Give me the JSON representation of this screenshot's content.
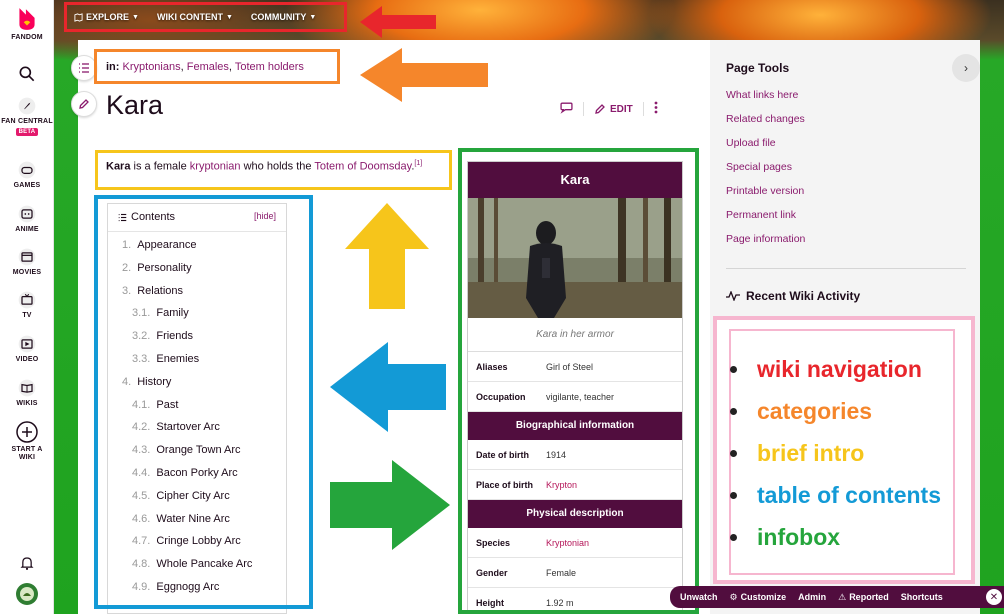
{
  "brand": {
    "name": "FANDOM"
  },
  "rail": {
    "items": [
      {
        "label": "FAN CENTRAL",
        "badge": "BETA",
        "icon": "rocket-icon"
      },
      {
        "label": "GAMES",
        "icon": "gamepad-icon"
      },
      {
        "label": "ANIME",
        "icon": "anime-icon"
      },
      {
        "label": "MOVIES",
        "icon": "movie-icon"
      },
      {
        "label": "TV",
        "icon": "tv-icon"
      },
      {
        "label": "VIDEO",
        "icon": "video-icon"
      },
      {
        "label": "WIKIS",
        "icon": "book-icon"
      },
      {
        "label": "START A WIKI",
        "icon": "plus-circle-icon"
      }
    ]
  },
  "topnav": {
    "items": [
      {
        "label": "EXPLORE"
      },
      {
        "label": "WIKI CONTENT"
      },
      {
        "label": "COMMUNITY"
      }
    ]
  },
  "article": {
    "categories_prefix": "in:",
    "categories": [
      "Kryptonians",
      "Females",
      "Totem holders"
    ],
    "title": "Kara",
    "edit_label": "EDIT",
    "intro": {
      "subject": "Kara",
      "text1": " is a female ",
      "link1": "kryptonian",
      "text2": " who holds the ",
      "link2": "Totem of Doomsday",
      "text3": ".",
      "ref": "[1]"
    }
  },
  "toc": {
    "title": "Contents",
    "hide_label": "[hide]",
    "items": [
      {
        "num": "1.",
        "label": "Appearance",
        "level": 1
      },
      {
        "num": "2.",
        "label": "Personality",
        "level": 1
      },
      {
        "num": "3.",
        "label": "Relations",
        "level": 1
      },
      {
        "num": "3.1.",
        "label": "Family",
        "level": 2
      },
      {
        "num": "3.2.",
        "label": "Friends",
        "level": 2
      },
      {
        "num": "3.3.",
        "label": "Enemies",
        "level": 2
      },
      {
        "num": "4.",
        "label": "History",
        "level": 1
      },
      {
        "num": "4.1.",
        "label": "Past",
        "level": 2
      },
      {
        "num": "4.2.",
        "label": "Startover Arc",
        "level": 2
      },
      {
        "num": "4.3.",
        "label": "Orange Town Arc",
        "level": 2
      },
      {
        "num": "4.4.",
        "label": "Bacon Porky Arc",
        "level": 2
      },
      {
        "num": "4.5.",
        "label": "Cipher City Arc",
        "level": 2
      },
      {
        "num": "4.6.",
        "label": "Water Nine Arc",
        "level": 2
      },
      {
        "num": "4.7.",
        "label": "Cringe Lobby Arc",
        "level": 2
      },
      {
        "num": "4.8.",
        "label": "Whole Pancake Arc",
        "level": 2
      },
      {
        "num": "4.9.",
        "label": "Eggnogg Arc",
        "level": 2
      }
    ]
  },
  "infobox": {
    "title": "Kara",
    "caption": "Kara in her armor",
    "rows_a": [
      {
        "key": "Aliases",
        "value": "Girl of Steel",
        "link": false
      },
      {
        "key": "Occupation",
        "value": "vigilante, teacher",
        "link": false
      }
    ],
    "section_bio": "Biographical information",
    "rows_b": [
      {
        "key": "Date of birth",
        "value": "1914",
        "link": false
      },
      {
        "key": "Place of birth",
        "value": "Krypton",
        "link": true
      }
    ],
    "section_phys": "Physical description",
    "rows_c": [
      {
        "key": "Species",
        "value": "Kryptonian",
        "link": true
      },
      {
        "key": "Gender",
        "value": "Female",
        "link": false
      },
      {
        "key": "Height",
        "value": "1.92 m",
        "link": false
      }
    ]
  },
  "page_tools": {
    "title": "Page Tools",
    "links": [
      "What links here",
      "Related changes",
      "Upload file",
      "Special pages",
      "Printable version",
      "Permanent link",
      "Page information"
    ]
  },
  "recent_activity": {
    "title": "Recent Wiki Activity"
  },
  "legend": {
    "items": [
      {
        "label": "wiki navigation",
        "color": "#e8262c"
      },
      {
        "label": "categories",
        "color": "#f5862b"
      },
      {
        "label": "brief intro",
        "color": "#f6c51b"
      },
      {
        "label": "table of contents",
        "color": "#139ad6"
      },
      {
        "label": "infobox",
        "color": "#25a53c"
      }
    ]
  },
  "annotation_colors": {
    "red": "#e8262c",
    "orange": "#f5862b",
    "yellow": "#f6c51b",
    "blue": "#139ad6",
    "green": "#25a53c",
    "pink": "#f6b6cf"
  },
  "toolbar": {
    "items": [
      "Unwatch",
      "Customize",
      "Admin",
      "Reported",
      "Shortcuts"
    ]
  }
}
